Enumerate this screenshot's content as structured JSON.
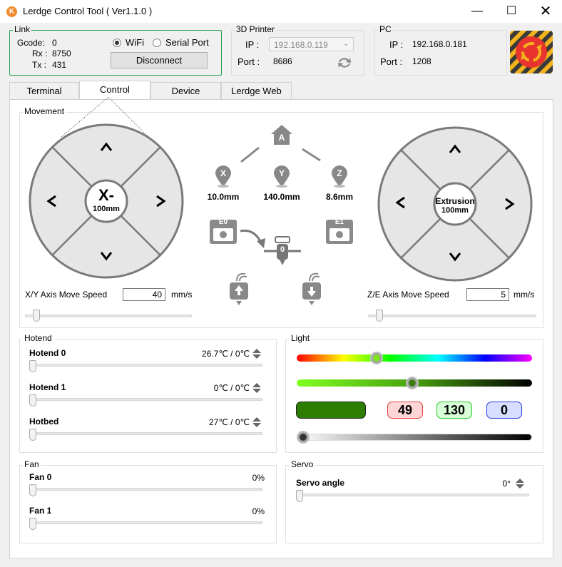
{
  "window": {
    "title": "Lerdge Control Tool ( Ver1.1.0 )"
  },
  "link": {
    "label": "Link",
    "gcode_label": "Gcode:",
    "gcode": "0",
    "rx_label": "Rx :",
    "rx": "8750",
    "tx_label": "Tx :",
    "tx": "431",
    "wifi_label": "WiFi",
    "serial_label": "Serial Port",
    "selected": "WiFi",
    "disconnect_label": "Disconnect"
  },
  "printer": {
    "label": "3D Printer",
    "ip_label": "IP :",
    "ip": "192.168.0.119",
    "port_label": "Port :",
    "port": "8686"
  },
  "pc": {
    "label": "PC",
    "ip_label": "IP :",
    "ip": "192.168.0.181",
    "port_label": "Port :",
    "port": "1208"
  },
  "tabs": [
    {
      "label": "Terminal"
    },
    {
      "label": "Control"
    },
    {
      "label": "Device"
    },
    {
      "label": "Lerdge Web"
    }
  ],
  "movement": {
    "label": "Movement",
    "left_pad": {
      "up": "^",
      "down": "v",
      "left": "<",
      "right": ">",
      "center_label": "X-",
      "center_sub": "100mm"
    },
    "right_pad": {
      "up": "^",
      "down": "v",
      "left": "<",
      "right": ">",
      "center_label": "Extrusion",
      "center_sub": "100mm"
    },
    "home_letter": "A",
    "x_letter": "X",
    "y_letter": "Y",
    "z_letter": "Z",
    "x_pos": "10.0mm",
    "y_pos": "140.0mm",
    "z_pos": "8.6mm",
    "e0_label": "E0",
    "e1_label": "E1",
    "nozzle_value": "0",
    "xy_speed_label": "X/Y  Axis Move Speed",
    "xy_speed": "40",
    "xy_unit": "mm/s",
    "ze_speed_label": "Z/E  Axis Move Speed",
    "ze_speed": "5",
    "ze_unit": "mm/s",
    "xy_speed_level": 0.05,
    "ze_speed_level": 0.05
  },
  "hotend": {
    "label": "Hotend",
    "items": [
      {
        "name": "Hotend 0",
        "value": "26.7℃ / 0℃"
      },
      {
        "name": "Hotend 1",
        "value": "0℃ / 0℃"
      },
      {
        "name": "Hotbed",
        "value": "27℃ / 0℃"
      }
    ]
  },
  "light": {
    "label": "Light",
    "r": "49",
    "g": "130",
    "b": "0",
    "hue_level": 0.33,
    "sat_level": 0.49,
    "bright_level": 0.0,
    "swatch_color": "#2d7d00"
  },
  "fan": {
    "label": "Fan",
    "items": [
      {
        "name": "Fan 0",
        "value": "0%"
      },
      {
        "name": "Fan 1",
        "value": "0%"
      }
    ]
  },
  "servo": {
    "label": "Servo",
    "name": "Servo angle",
    "value": "0°"
  }
}
